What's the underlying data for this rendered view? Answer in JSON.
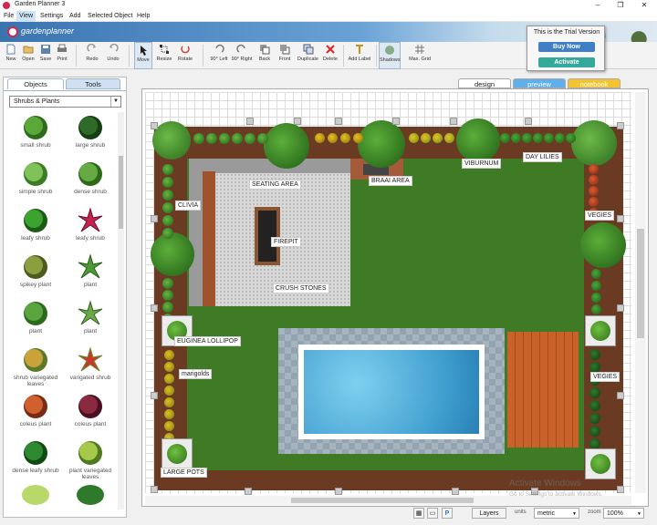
{
  "window": {
    "title": "Garden Planner 3"
  },
  "menu": [
    "File",
    "View",
    "Settings",
    "Add",
    "Selected Object",
    "Help"
  ],
  "brand": "gardenplanner",
  "toolbar": {
    "items": [
      "New",
      "Open",
      "Save",
      "Print",
      "Redo",
      "Undo",
      "Move",
      "Resize",
      "Rotate",
      "90° Left",
      "90° Right",
      "Back",
      "Front",
      "Duplicate",
      "Delete",
      "Add Label",
      "Shadows",
      "Max. Grid"
    ]
  },
  "trial": {
    "text": "This is the Trial Version",
    "buy": "Buy Now",
    "activate": "Activate"
  },
  "left_panel": {
    "tabs": [
      "Objects",
      "Tools"
    ],
    "category": "Shrubs & Plants",
    "plants": [
      "small shrub",
      "large shrub",
      "simple shrub",
      "dense shrub",
      "leafy shrub",
      "leafy shrub",
      "spikey plant",
      "plant",
      "plant",
      "plant",
      "shrub variegated leaves",
      "varigated shrub",
      "coleus plant",
      "coleus plant",
      "dense leafy shrub",
      "plant variegated leaves"
    ]
  },
  "view_tabs": [
    "design",
    "preview",
    "notebook"
  ],
  "plan_labels": {
    "seating": "SEATING AREA",
    "braai": "BRAAI AREA",
    "viburnum": "VIBURNUM",
    "daylilies": "DAY LILIES",
    "clivia": "CLIVIA",
    "vegies1": "VEGIES",
    "firepit": "FIREPIT",
    "crush": "CRUSH STONES",
    "euginea": "EUGINEA LOLLIPOP",
    "marigolds": "marigolds",
    "vegies2": "VEGIES",
    "pots": "LARGE POTS"
  },
  "status": {
    "layers": "Layers",
    "units_label": "units",
    "units_value": "metric",
    "zoom_label": "zoom",
    "zoom_value": "100%"
  },
  "watermark": {
    "line1": "Activate Windows",
    "line2": "Go to Settings to activate Windows."
  },
  "colors": {
    "accent": "#3a74b0",
    "brand_red": "#d2264a",
    "lawn": "#3f7a25",
    "bed": "#6a3b22",
    "pool": "#4aa7cf",
    "buy": "#3f7fc8",
    "activate": "#34a89a",
    "preview_tab": "#5fb0ea",
    "notebook_tab": "#f4c430"
  }
}
